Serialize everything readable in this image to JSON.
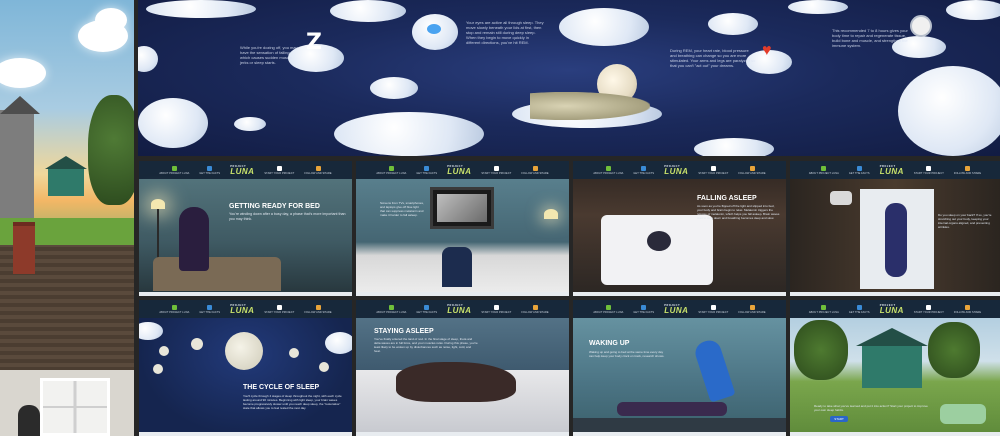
{
  "banner": {
    "texts": [
      "While you're dozing off, you may have the sensation of falling, which causes sudden muscle jerks or sleep starts.",
      "Your eyes are active all through sleep. They move slowly beneath your lids at first, then stop and remain still during deep sleep. When they begin to move quickly in different directions, you've hit REM.",
      "During REM, your heart rate, blood pressure and breathing can change so you are more stimulated. Your arms and legs are paralyzed so that you can't \"act out\" your dreams.",
      "This recommended 7 to 8 hours gives your body time to repair and regenerate tissue, build bone and muscle, and strengthen the immune system."
    ],
    "z_glyph": "Z"
  },
  "nav": {
    "logo": "LUNA",
    "logo_top": "PROJECT",
    "items": [
      "ABOUT PROJECT LUNA",
      "GET THE FACTS",
      "START YOUR PROJECT",
      "FOLLOW AND SHARE"
    ]
  },
  "tiles": {
    "getting_ready": {
      "title": "GETTING READY FOR BED",
      "text": "You're winding down after a busy day, a phase that's more important than you may think."
    },
    "tv_text": "Screens from TVs, smartphones, and laptops give off blue light that can suppress melatonin and make it harder to fall asleep.",
    "falling_asleep": {
      "title": "FALLING ASLEEP",
      "text": "As soon as you're flipped off the light and slipped into bed, your body and brain begin to relax. Melatonin triggers the release of melatonin, which helps you fall asleep. Brain waves start to slow down and breathing becomes deep and slow."
    },
    "overhead_text": "Do you sleep on your back? If so, you're stretching out your body, keeping your internal organs aligned, and preventing wrinkles.",
    "cycle": {
      "title": "THE CYCLE OF SLEEP",
      "text": "You'll cycle through 4 stages of sleep throughout the night, with each cycle lasting around 90 minutes. Beginning with light sleep, your brain waves become progressively slower until you reach deep sleep, the \"restorative\" state that allows you to feel rested the next day."
    },
    "staying": {
      "title": "STAYING ASLEEP",
      "text": "You've finally entered the land of nod. In the final stage of sleep, theta and delta waves are in full force, and your muscles relax. During this phase, you're least likely to be woken up by disturbances such as noise, light, cold, and heat."
    },
    "waking": {
      "title": "WAKING UP",
      "text": "Waking up and going to bed at the same time every day can help keep your body clock on track, research shows."
    },
    "final_text": "Ready to take what you've learned and put it into action? Start your project to improve your own sleep habits.",
    "start_label": "START"
  },
  "colors": {
    "logo": "#c9e26b",
    "nav_bg": "#17283a",
    "banner_bg": "#1b2a5c",
    "heart": "#e43c2a",
    "nav_icons": [
      "#6fbf3a",
      "#3a8bd6",
      "#ffffff",
      "#e8a43a"
    ]
  }
}
